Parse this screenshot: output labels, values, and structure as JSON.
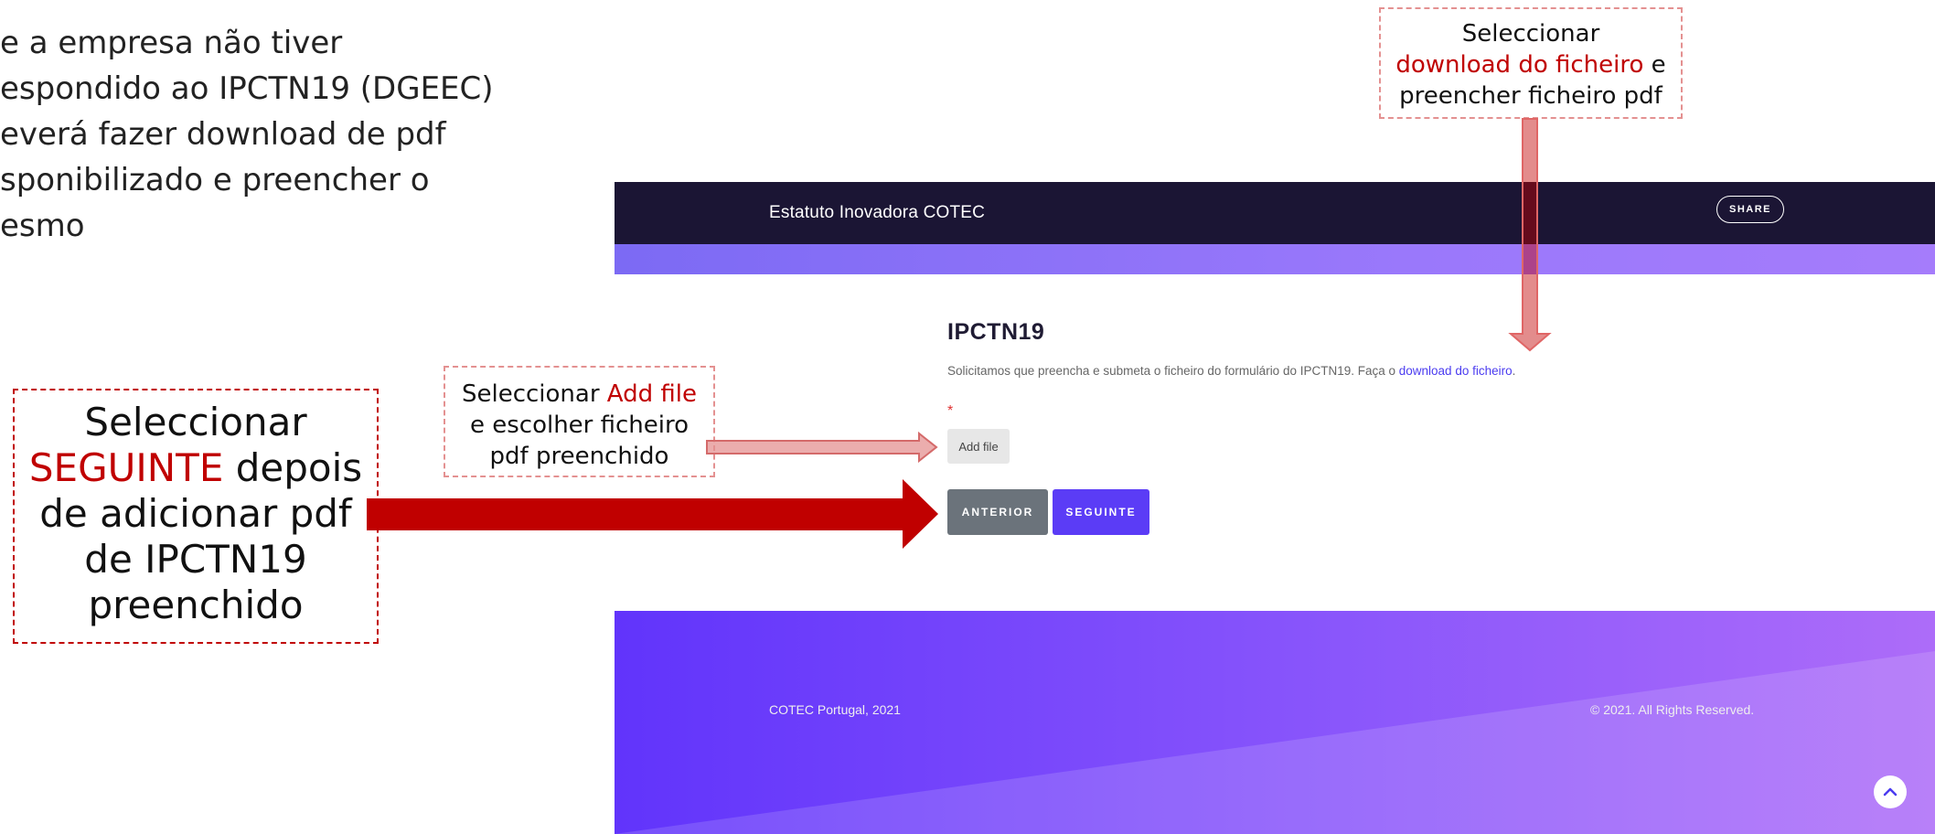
{
  "slide": {
    "intro_text": "e a empresa não tiver\nespondido ao IPCTN19 (DGEEC)\neverá fazer download de pdf\nsponibilizado e preencher o\nesmo",
    "callout_top": {
      "line1": "Seleccionar",
      "highlight": "download do ficheiro",
      "after": " e",
      "line3": "preencher ficheiro pdf"
    },
    "callout_mid": {
      "before": "Seleccionar ",
      "highlight": "Add file",
      "line2": "e escolher ficheiro",
      "line3": "pdf preenchido"
    },
    "callout_left": {
      "line1": "Seleccionar",
      "highlight": "SEGUINTE",
      "after": " depois",
      "line3": "de adicionar pdf",
      "line4": "de IPCTN19",
      "line5": "preenchido"
    }
  },
  "app": {
    "header": {
      "brand": "Estatuto Inovadora COTEC",
      "share_label": "SHARE"
    },
    "form": {
      "title": "IPCTN19",
      "description": "Solicitamos que preencha e submeta o ficheiro do formulário do IPCTN19. Faça o ",
      "download_link": "download do ficheiro",
      "description_end": ".",
      "required_mark": "*",
      "add_file_label": "Add file",
      "previous_label": "ANTERIOR",
      "next_label": "SEGUINTE"
    },
    "footer": {
      "left_text": "COTEC Portugal, 2021",
      "right_text": "© 2021. All Rights Reserved."
    }
  },
  "colors": {
    "header_bg": "#1b1534",
    "accent": "#5b3cf6",
    "annotation_red": "#c00000",
    "arrow_pink": "#e49191"
  }
}
